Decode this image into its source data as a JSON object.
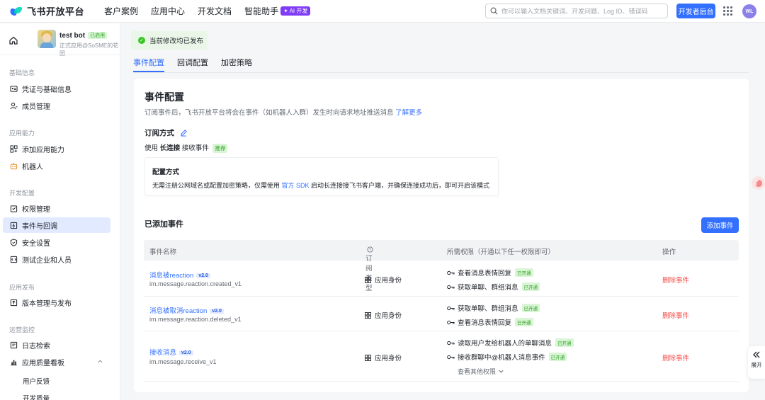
{
  "brand": {
    "name": "飞书开放平台"
  },
  "nav": {
    "items": [
      "客户案例",
      "应用中心",
      "开发文档",
      "智能助手"
    ],
    "ai_badge": "✦ AI 开发"
  },
  "search": {
    "placeholder": "你可以输入文档关键词、开发问题、Log ID、错误码"
  },
  "dev_console_label": "开发者后台",
  "user": {
    "initials": "WL"
  },
  "app": {
    "name": "test bot",
    "status": "已启用",
    "desc": "正式应用@SoSME的花园"
  },
  "sidebar": {
    "sections": [
      {
        "title": "基础信息",
        "items": [
          "凭证与基础信息",
          "成员管理"
        ]
      },
      {
        "title": "应用能力",
        "items": [
          "添加应用能力",
          "机器人"
        ]
      },
      {
        "title": "开发配置",
        "items": [
          "权限管理",
          "事件与回调",
          "安全设置",
          "测试企业和人员"
        ]
      },
      {
        "title": "应用发布",
        "items": [
          "版本管理与发布"
        ]
      },
      {
        "title": "运营监控",
        "items": [
          "日志检索",
          "应用质量看板"
        ]
      }
    ],
    "sub_items": [
      "用户反馈",
      "开发质量"
    ]
  },
  "toast": {
    "text": "当前修改均已发布"
  },
  "tabs": [
    "事件配置",
    "回调配置",
    "加密策略"
  ],
  "event_config": {
    "title": "事件配置",
    "desc": "订阅事件后，飞书开放平台将会在事件（如机器人入群）发生时向请求地址推送消息 ",
    "learn_more": "了解更多",
    "subscribe_title": "订阅方式",
    "use_prefix": "使用",
    "use_mode": "长连接",
    "use_suffix": "接收事件",
    "recommend": "推荐",
    "cfg_title": "配置方式",
    "cfg_text_1": "无需注册公网域名或配置加密策略，仅需使用 ",
    "cfg_link": "官方 SDK",
    "cfg_text_2": " 启动长连接接飞书客户端，并确保连接成功后，即可开启该模式"
  },
  "added": {
    "title": "已添加事件",
    "add_button": "添加事件",
    "columns": [
      "事件名称",
      "订阅类型",
      "所需权限（开通以下任一权限即可）",
      "操作"
    ],
    "rows": [
      {
        "name": "消息被reaction",
        "version": "v2.0",
        "code": "im.message.reaction.created_v1",
        "type": "应用身份",
        "perms": [
          {
            "label": "查看消息表情回复",
            "status": "已开通"
          },
          {
            "label": "获取单聊、群组消息",
            "status": "已开通"
          }
        ],
        "action": "删除事件"
      },
      {
        "name": "消息被取消reaction",
        "version": "v2.0",
        "code": "im.message.reaction.deleted_v1",
        "type": "应用身份",
        "perms": [
          {
            "label": "获取单聊、群组消息",
            "status": "已开通"
          },
          {
            "label": "查看消息表情回复",
            "status": "已开通"
          }
        ],
        "action": "删除事件"
      },
      {
        "name": "接收消息",
        "version": "v2.0",
        "code": "im.message.receive_v1",
        "type": "应用身份",
        "perms": [
          {
            "label": "读取用户发给机器人的单聊消息",
            "status": "已开通"
          },
          {
            "label": "接收群聊中@机器人消息事件",
            "status": "已开通"
          }
        ],
        "more": "查看其他权限",
        "action": "删除事件"
      }
    ]
  },
  "expand_label": "展开",
  "colors": {
    "primary": "#3370ff",
    "danger": "#f54a45",
    "success": "#2ea121",
    "active_bg": "#e1eaff"
  }
}
